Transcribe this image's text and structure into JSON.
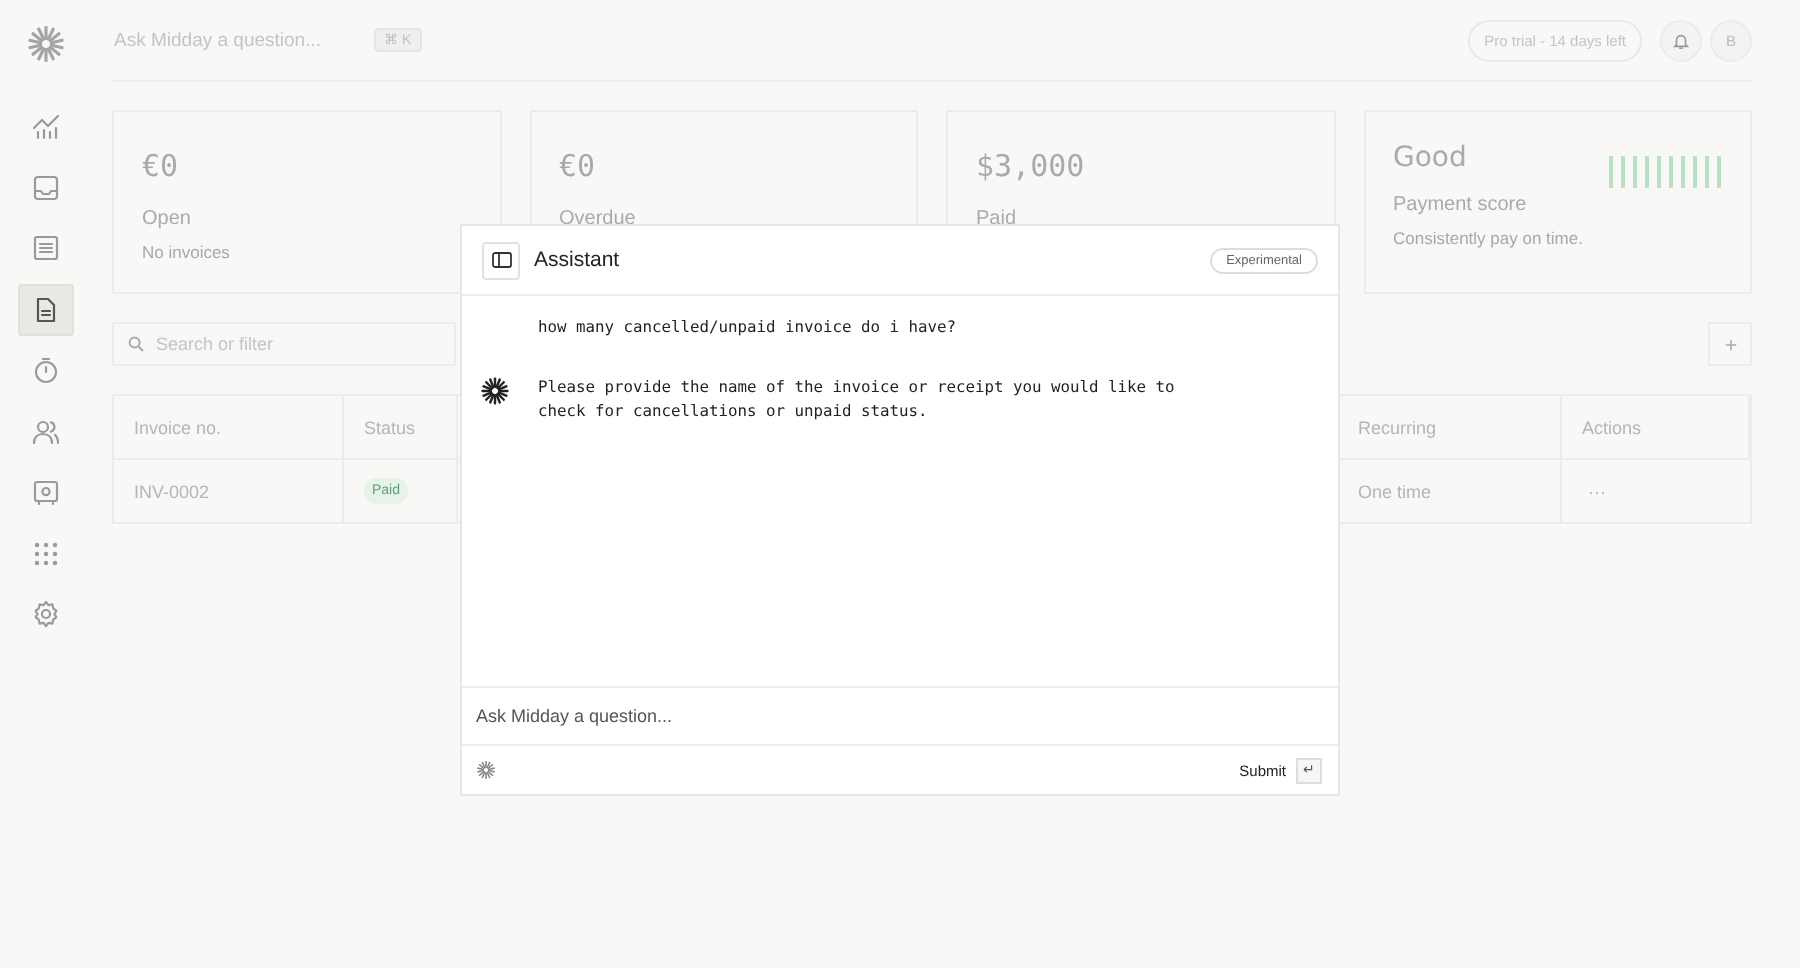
{
  "topbar": {
    "search_placeholder": "Ask Midday a question...",
    "shortcut": "⌘ K",
    "trial": "Pro trial - 14 days left",
    "avatar": "B"
  },
  "sidebar": {
    "items": [
      {
        "kind": "chart",
        "selected": false
      },
      {
        "kind": "inbox",
        "selected": false
      },
      {
        "kind": "list",
        "selected": false
      },
      {
        "kind": "document",
        "selected": true
      },
      {
        "kind": "timer",
        "selected": false
      },
      {
        "kind": "people",
        "selected": false
      },
      {
        "kind": "vault",
        "selected": false
      },
      {
        "kind": "apps",
        "selected": false
      },
      {
        "kind": "settings",
        "selected": false
      }
    ]
  },
  "cards": [
    {
      "kind": "amount",
      "value": "€0",
      "label": "Open",
      "note": "No invoices"
    },
    {
      "kind": "amount",
      "value": "€0",
      "label": "Overdue"
    },
    {
      "kind": "amount",
      "value": "$3,000",
      "label": "Paid"
    },
    {
      "kind": "score",
      "value": "Good",
      "label": "Payment score",
      "note": "Consistently pay on time."
    }
  ],
  "filter": {
    "placeholder": "Search or filter"
  },
  "table": {
    "columns": [
      "Invoice no.",
      "Status",
      "Recurring",
      "Actions"
    ],
    "rows": [
      {
        "invoice": "INV-0002",
        "status": "Paid",
        "recurring": "One time",
        "actions": "···"
      }
    ]
  },
  "assistant": {
    "title": "Assistant",
    "badge": "Experimental",
    "messages": [
      {
        "kind": "user",
        "text": "how many cancelled/unpaid invoice do i have?"
      },
      {
        "kind": "assistant",
        "text": "Please provide the name of the invoice or receipt you would like to check for cancellations or unpaid status."
      }
    ],
    "input_placeholder": "Ask Midday a question...",
    "submit": "Submit",
    "submit_key": "↵"
  }
}
